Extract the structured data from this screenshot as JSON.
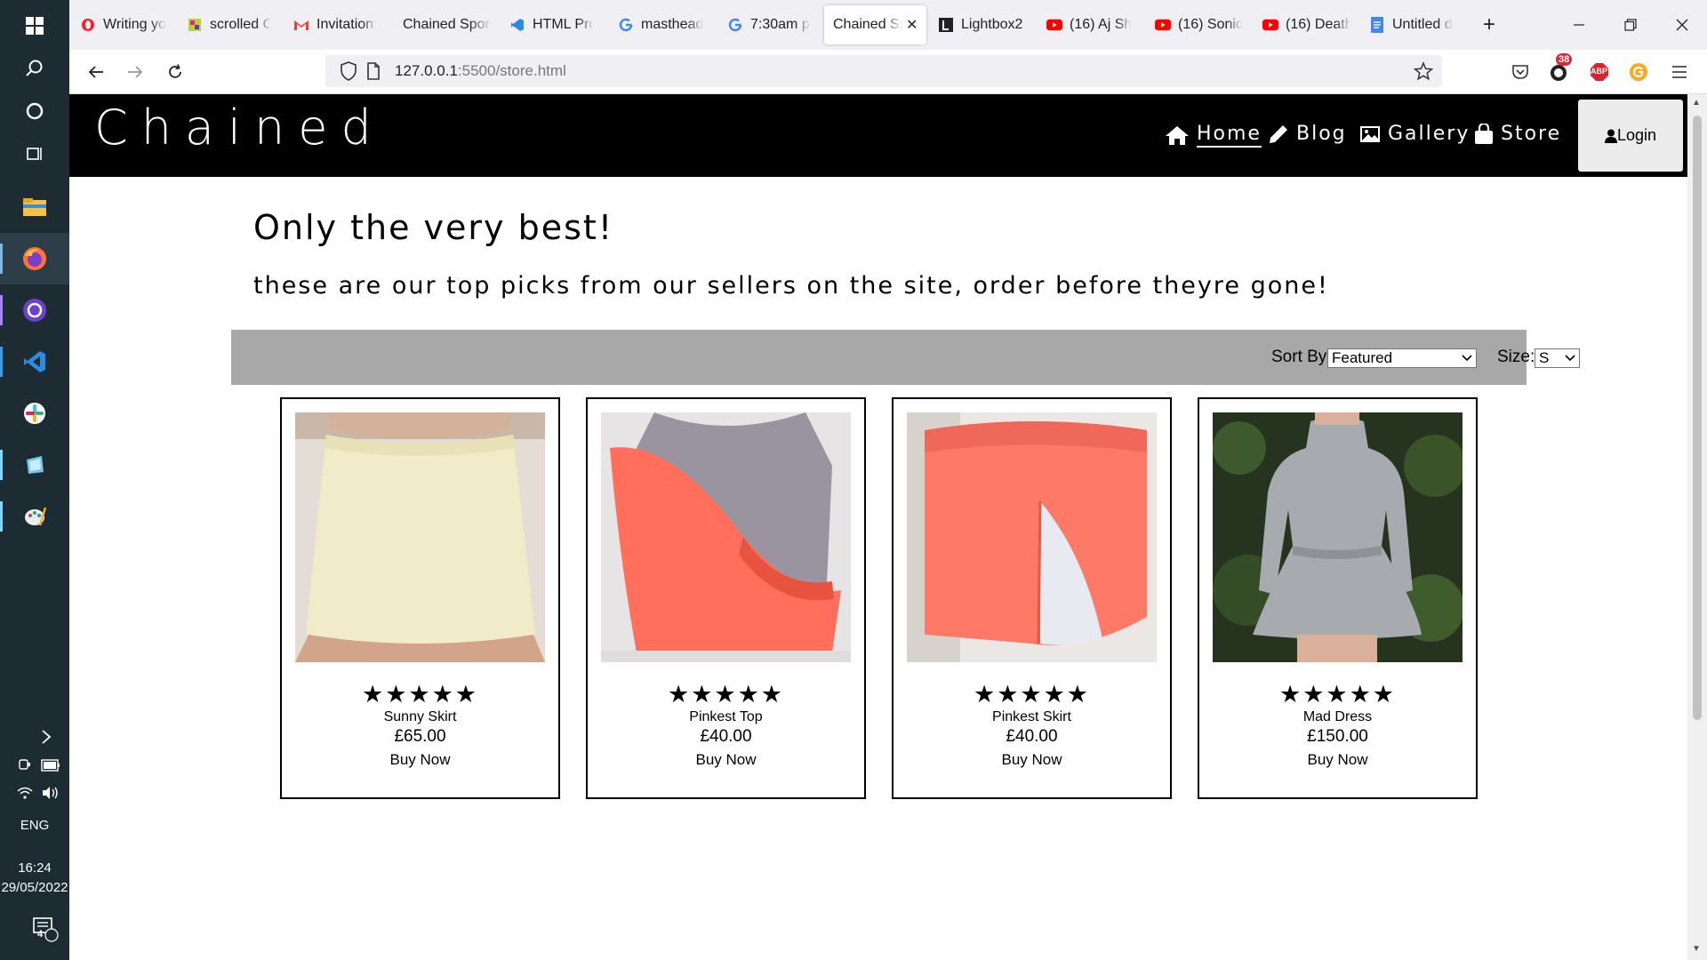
{
  "browser": {
    "tabs": [
      {
        "title": "Writing yo",
        "icon": "opera-icon"
      },
      {
        "title": "scrolled C",
        "icon": "app-icon"
      },
      {
        "title": "Invitation:",
        "icon": "gmail-icon"
      },
      {
        "title": "Chained Sport",
        "icon": "blank-icon"
      },
      {
        "title": "HTML Pro",
        "icon": "vscode-icon"
      },
      {
        "title": "masthead",
        "icon": "google-icon"
      },
      {
        "title": "7:30am p",
        "icon": "google-icon"
      },
      {
        "title": "Chained Sp",
        "icon": "blank-icon",
        "active": true
      },
      {
        "title": "Lightbox2",
        "icon": "lightbox-icon"
      },
      {
        "title": "(16) Aj Sh",
        "icon": "youtube-icon"
      },
      {
        "title": "(16) Sonic",
        "icon": "youtube-icon"
      },
      {
        "title": "(16) Death",
        "icon": "youtube-icon"
      },
      {
        "title": "Untitled d",
        "icon": "docs-icon"
      }
    ],
    "url_host": "127.0.0.1",
    "url_rest": ":5500/store.html",
    "notification_badge": "38",
    "abp_label": "ABP"
  },
  "taskbar": {
    "language": "ENG",
    "time": "16:24",
    "date": "29/05/2022",
    "notification_count": "4"
  },
  "site": {
    "brand": "Chained",
    "nav": [
      {
        "label": "Home",
        "icon": "home-icon",
        "current": true
      },
      {
        "label": "Blog",
        "icon": "pencil-icon"
      },
      {
        "label": "Gallery",
        "icon": "image-icon"
      },
      {
        "label": "Store",
        "icon": "shopping-bag-icon"
      }
    ],
    "login_label": "Login"
  },
  "content": {
    "heading": "Only the very best!",
    "subheading": "these are our top picks from our sellers on the site, order before theyre gone!"
  },
  "filters": {
    "sort_label": "Sort By:",
    "sort_value": "Featured",
    "size_label": "Size:",
    "size_value": "S"
  },
  "products": [
    {
      "name": "Sunny Skirt",
      "price": "£65.00",
      "stars": "★★★★★",
      "buy_label": "Buy Now",
      "rating": 5
    },
    {
      "name": "Pinkest Top",
      "price": "£40.00",
      "stars": "★★★★★",
      "buy_label": "Buy Now",
      "rating": 5
    },
    {
      "name": "Pinkest Skirt",
      "price": "£40.00",
      "stars": "★★★★★",
      "buy_label": "Buy Now",
      "rating": 5
    },
    {
      "name": "Mad Dress",
      "price": "£150.00",
      "stars": "★★★★★",
      "buy_label": "Buy Now",
      "rating": 5
    }
  ],
  "colors": {
    "site_header_bg": "#000000",
    "filter_bar_bg": "#a8a8a8",
    "login_bg": "#ececec"
  }
}
